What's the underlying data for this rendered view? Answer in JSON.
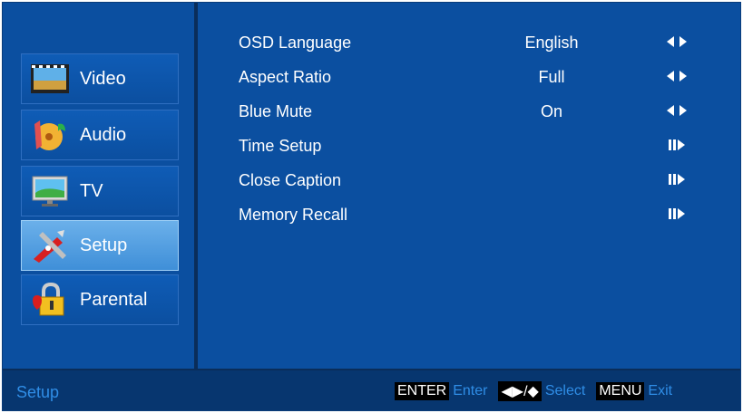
{
  "sidebar": {
    "items": [
      {
        "label": "Video",
        "icon": "video-icon",
        "active": false
      },
      {
        "label": "Audio",
        "icon": "audio-icon",
        "active": false
      },
      {
        "label": "TV",
        "icon": "tv-icon",
        "active": false
      },
      {
        "label": "Setup",
        "icon": "setup-icon",
        "active": true
      },
      {
        "label": "Parental",
        "icon": "parental-icon",
        "active": false
      }
    ]
  },
  "menu": {
    "rows": [
      {
        "name": "OSD Language",
        "value": "English",
        "arrow": "left-right-arrows-icon"
      },
      {
        "name": "Aspect Ratio",
        "value": "Full",
        "arrow": "left-right-arrows-icon"
      },
      {
        "name": "Blue Mute",
        "value": "On",
        "arrow": "left-right-arrows-icon"
      },
      {
        "name": "Time Setup",
        "value": "",
        "arrow": "submenu-arrow-icon"
      },
      {
        "name": "Close Caption",
        "value": "",
        "arrow": "submenu-arrow-icon"
      },
      {
        "name": "Memory Recall",
        "value": "",
        "arrow": "submenu-arrow-icon"
      }
    ]
  },
  "footer": {
    "title": "Setup",
    "enter_key": "ENTER",
    "enter_desc": "Enter",
    "select_key": "◀▶/◆",
    "select_desc": "Select",
    "menu_key": "MENU",
    "menu_desc": "Exit"
  },
  "colors": {
    "background": "#0b4fa0",
    "active_item": "#5aa5e6",
    "footer_text": "#2f8de6"
  }
}
